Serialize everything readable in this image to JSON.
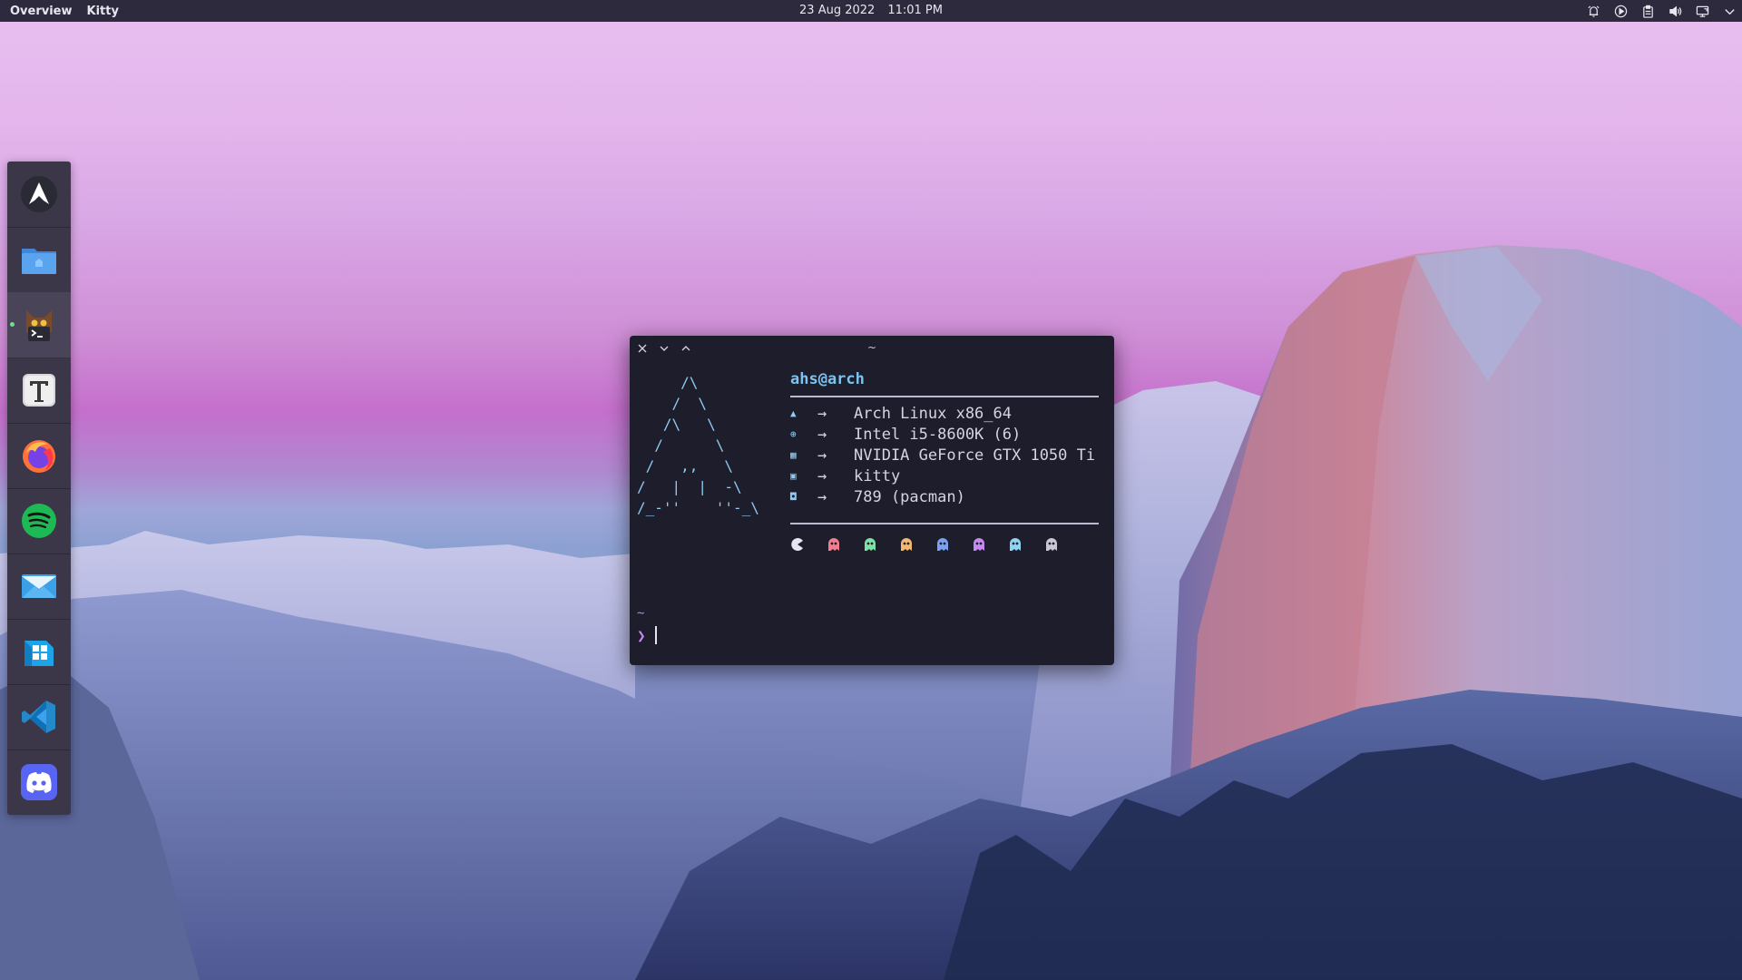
{
  "topbar": {
    "activities": "Overview",
    "app_name": "Kitty",
    "date": "23 Aug 2022",
    "time": "11:01 PM",
    "tray_icons": [
      "alarm-icon",
      "media-play-icon",
      "clipboard-icon",
      "volume-icon",
      "display-icon",
      "chevron-down-icon"
    ]
  },
  "dock": {
    "items": [
      {
        "name": "arch-linux-logo"
      },
      {
        "name": "files"
      },
      {
        "name": "kitty-terminal",
        "running": true
      },
      {
        "name": "text-editor"
      },
      {
        "name": "firefox"
      },
      {
        "name": "spotify"
      },
      {
        "name": "mail"
      },
      {
        "name": "software-store"
      },
      {
        "name": "visual-studio-code"
      },
      {
        "name": "discord"
      }
    ]
  },
  "terminal": {
    "title": "~",
    "ascii_logo": "     /\\\n    /  \\\n   /\\   \\\n  /      \\\n /   ,,   \\\n/   |  |  -\\\n/_-''    ''-_\\",
    "userhost": "ahs@arch",
    "info": [
      {
        "icon": "arch-icon",
        "value": "Arch Linux x86_64"
      },
      {
        "icon": "cpu-icon",
        "value": "Intel i5-8600K (6)"
      },
      {
        "icon": "gpu-icon",
        "value": "NVIDIA GeForce GTX 1050 Ti"
      },
      {
        "icon": "terminal-icon",
        "value": "kitty"
      },
      {
        "icon": "package-icon",
        "value": "789 (pacman)"
      }
    ],
    "arrow": "→",
    "ghost_colors": [
      "#e6e4f0",
      "#f07e8e",
      "#7fe0a8",
      "#f0b870",
      "#7aa2f0",
      "#c58af0",
      "#8fd4f0",
      "#c9c7d6"
    ],
    "prompt_dir": "~",
    "prompt_char": "❯"
  }
}
